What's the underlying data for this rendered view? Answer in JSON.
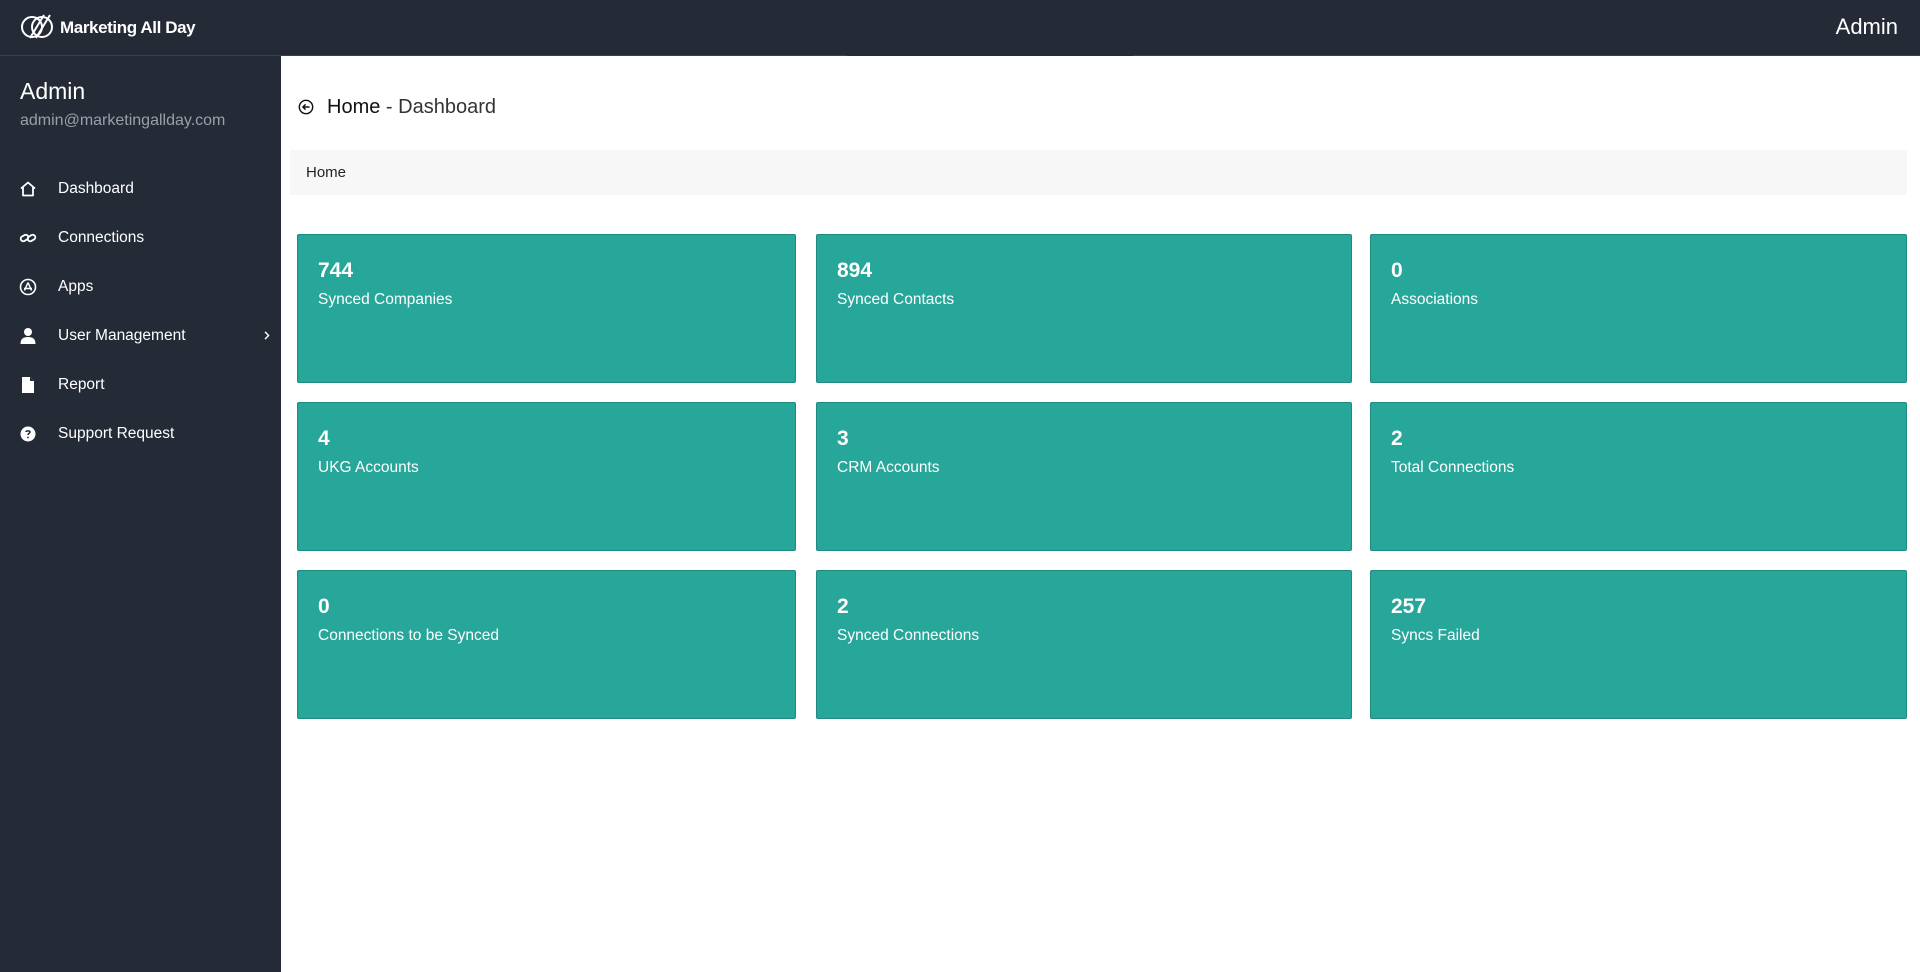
{
  "brand": {
    "name": "Marketing All Day"
  },
  "topbar": {
    "user": "Admin"
  },
  "profile": {
    "name": "Admin",
    "email": "admin@marketingallday.com"
  },
  "sidebar": {
    "items": [
      {
        "label": "Dashboard",
        "icon": "home-icon"
      },
      {
        "label": "Connections",
        "icon": "link-icon"
      },
      {
        "label": "Apps",
        "icon": "apps-icon"
      },
      {
        "label": "User Management",
        "icon": "user-icon",
        "has_submenu": true
      },
      {
        "label": "Report",
        "icon": "file-icon"
      },
      {
        "label": "Support Request",
        "icon": "help-icon"
      }
    ]
  },
  "header": {
    "title": "Home",
    "separator": " - ",
    "subtitle": "Dashboard"
  },
  "breadcrumb": {
    "items": [
      "Home"
    ]
  },
  "stats": [
    {
      "value": "744",
      "label": "Synced Companies"
    },
    {
      "value": "894",
      "label": "Synced Contacts"
    },
    {
      "value": "0",
      "label": "Associations"
    },
    {
      "value": "4",
      "label": "UKG Accounts"
    },
    {
      "value": "3",
      "label": "CRM Accounts"
    },
    {
      "value": "2",
      "label": "Total Connections"
    },
    {
      "value": "0",
      "label": "Connections to be Synced"
    },
    {
      "value": "2",
      "label": "Synced Connections"
    },
    {
      "value": "257",
      "label": "Syncs Failed"
    }
  ],
  "colors": {
    "sidebar_bg": "#242a36",
    "card_bg": "#27a69a",
    "card_border": "#1f8b80",
    "breadcrumb_bg": "#f7f7f7"
  }
}
